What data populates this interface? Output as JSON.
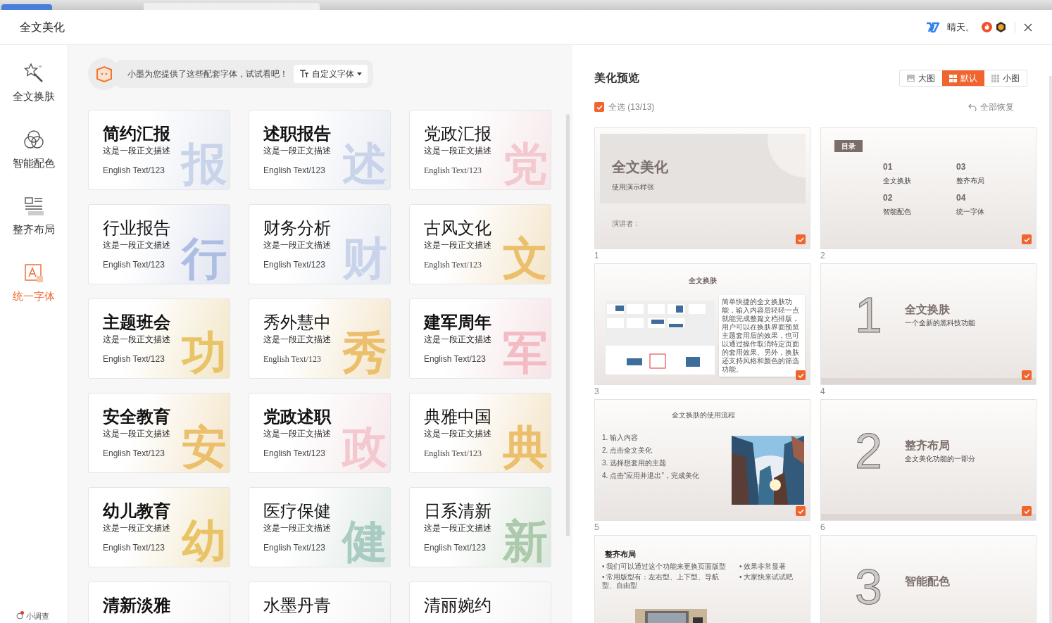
{
  "window": {
    "title": "全文美化",
    "user": "晴天。"
  },
  "sidebar": {
    "items": [
      {
        "label": "全文换肤",
        "selected": false
      },
      {
        "label": "智能配色",
        "selected": false
      },
      {
        "label": "整齐布局",
        "selected": false
      },
      {
        "label": "统一字体",
        "selected": true
      }
    ],
    "survey": "小调查"
  },
  "hint": {
    "text": "小墨为您提供了这些配套字体，试试看吧！",
    "button": "自定义字体"
  },
  "fonts": [
    {
      "title": "简约汇报",
      "desc": "这是一段正文描述",
      "english": "English Text/123",
      "mark": "报",
      "kind": "heavy",
      "color": "#c9d3ea"
    },
    {
      "title": "述职报告",
      "desc": "这是一段正文描述",
      "english": "English Text/123",
      "mark": "述",
      "kind": "heavy",
      "color": "#c9d3ea"
    },
    {
      "title": "党政汇报",
      "desc": "这是一段正文描述",
      "english": "English Text/123",
      "mark": "党",
      "kind": "serif",
      "color": "#f3c9cf"
    },
    {
      "title": "行业报告",
      "desc": "这是一段正文描述",
      "english": "English Text/123",
      "mark": "行",
      "kind": "regular",
      "color": "#aebde3"
    },
    {
      "title": "财务分析",
      "desc": "这是一段正文描述",
      "english": "English Text/123",
      "mark": "财",
      "kind": "regular",
      "color": "#c9d3ea"
    },
    {
      "title": "古风文化",
      "desc": "这是一段正文描述",
      "english": "English Text/123",
      "mark": "文",
      "kind": "serif",
      "color": "#ebbf6c"
    },
    {
      "title": "主题班会",
      "desc": "这是一段正文描述",
      "english": "English Text/123",
      "mark": "功",
      "kind": "heavy",
      "color": "#e8c466"
    },
    {
      "title": "秀外慧中",
      "desc": "这是一段正文描述",
      "english": "English Text/123",
      "mark": "秀",
      "kind": "serif",
      "color": "#ebbf6c"
    },
    {
      "title": "建军周年",
      "desc": "这是一段正文描述",
      "english": "English Text/123",
      "mark": "军",
      "kind": "heavy",
      "color": "#f3bcc4"
    },
    {
      "title": "安全教育",
      "desc": "这是一段正文描述",
      "english": "English Text/123",
      "mark": "安",
      "kind": "heavy",
      "color": "#ebbf6c"
    },
    {
      "title": "党政述职",
      "desc": "这是一段正文描述",
      "english": "English Text/123",
      "mark": "政",
      "kind": "heavy",
      "color": "#f3c9cf"
    },
    {
      "title": "典雅中国",
      "desc": "这是一段正文描述",
      "english": "English Text/123",
      "mark": "典",
      "kind": "serif",
      "color": "#ebbf6c"
    },
    {
      "title": "幼儿教育",
      "desc": "这是一段正文描述",
      "english": "English Text/123",
      "mark": "幼",
      "kind": "heavy",
      "color": "#e8c466"
    },
    {
      "title": "医疗保健",
      "desc": "这是一段正文描述",
      "english": "English Text/123",
      "mark": "健",
      "kind": "regular",
      "color": "#a9cbc1"
    },
    {
      "title": "日系清新",
      "desc": "这是一段正文描述",
      "english": "English Text/123",
      "mark": "新",
      "kind": "regular",
      "color": "#abc9ab"
    },
    {
      "title": "清新淡雅",
      "kind": "heavy"
    },
    {
      "title": "水墨丹青",
      "kind": "serif"
    },
    {
      "title": "清丽婉约",
      "kind": "serif"
    }
  ],
  "preview": {
    "title": "美化预览",
    "views": [
      {
        "label": "大图",
        "selected": false
      },
      {
        "label": "默认",
        "selected": true
      },
      {
        "label": "小图",
        "selected": false
      }
    ],
    "select_all": {
      "label": "全选 (13/13)",
      "checked": true
    },
    "restore": "全部恢复",
    "slides": [
      {
        "number": "1",
        "checked": true,
        "kind": "cover",
        "title": "全文美化",
        "subtitle": "使用演示样张",
        "footer": "演讲者："
      },
      {
        "number": "2",
        "checked": true,
        "kind": "toc",
        "title": "目录",
        "entries": [
          {
            "num": "01",
            "label": "全文换肤"
          },
          {
            "num": "03",
            "label": "整齐布局"
          },
          {
            "num": "02",
            "label": "智能配色"
          },
          {
            "num": "04",
            "label": "统一字体"
          }
        ]
      },
      {
        "number": "3",
        "checked": true,
        "kind": "screens",
        "title": "全文换肤",
        "body": "简单快捷的全文换肤功能，输入内容后轻轻一点就能完成整篇文档排版，用户可以在换肤界面预览主题套用后的效果，也可以通过操作取消特定页面的套用效果。另外，换肤还支持风格和颜色的筛选功能。"
      },
      {
        "number": "4",
        "checked": true,
        "kind": "section",
        "digit": "1",
        "title": "全文换肤",
        "subtitle": "一个全新的黑科技功能"
      },
      {
        "number": "5",
        "checked": true,
        "kind": "steps",
        "title": "全文换肤的使用流程",
        "steps": [
          "1. 输入内容",
          "2. 点击全文美化",
          "3. 选择想套用的主题",
          "4. 点击“应用并退出”，完成美化"
        ]
      },
      {
        "number": "6",
        "checked": true,
        "kind": "section",
        "digit": "2",
        "title": "整齐布局",
        "subtitle": "全文美化功能的一部分"
      },
      {
        "kind": "bullets",
        "title": "整齐布局",
        "left": [
          "• 我们可以通过这个功能来更换页面版型",
          "• 常用版型有：左右型、上下型、导航型、自由型"
        ],
        "right": [
          "• 效果非常显著",
          "• 大家快来试试吧"
        ]
      },
      {
        "kind": "section",
        "digit": "3",
        "title": "智能配色"
      }
    ]
  }
}
